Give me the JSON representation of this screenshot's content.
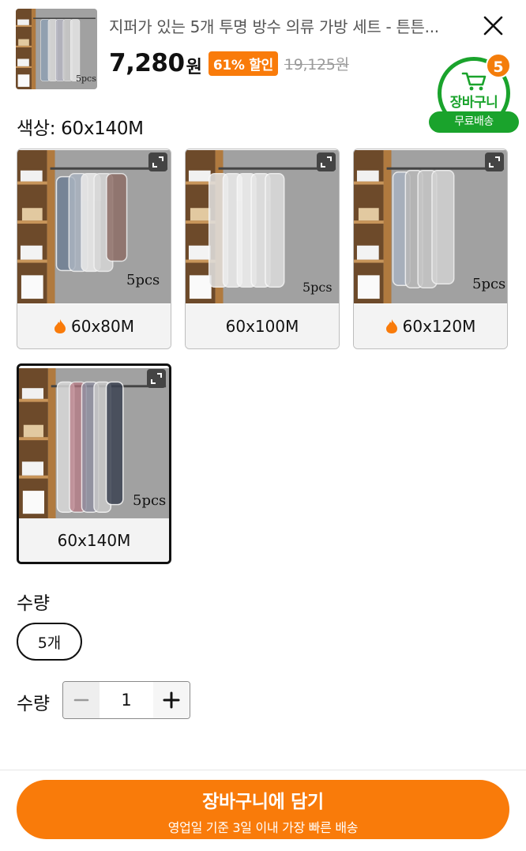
{
  "header": {
    "title": "지퍼가 있는 5개 투명 방수 의류 가방 세트 - 튼튼...",
    "price": "7,280",
    "currency": "원",
    "discount_badge": "61% 할인",
    "original_price": "19,125원",
    "thumb_caption": "5pcs"
  },
  "cart": {
    "count": "5",
    "label": "장바구니",
    "free_shipping": "무료배송"
  },
  "color": {
    "label": "색상: 60x140M",
    "options": [
      {
        "label": "60x80M",
        "caption": "5pcs",
        "hot": true
      },
      {
        "label": "60x100M",
        "caption": "5pcs",
        "hot": false
      },
      {
        "label": "60x120M",
        "caption": "5pcs",
        "hot": true
      },
      {
        "label": "60x140M",
        "caption": "5pcs",
        "hot": false,
        "selected": true
      }
    ]
  },
  "pack": {
    "label": "수량",
    "option": "5개"
  },
  "quantity": {
    "label": "수량",
    "value": "1"
  },
  "cta": {
    "main": "장바구니에 담기",
    "sub": "영업일 기준 3일 이내 가장 빠른 배송"
  },
  "colors": {
    "accent_orange": "#f97b0a",
    "cart_green": "#1aa32c"
  }
}
